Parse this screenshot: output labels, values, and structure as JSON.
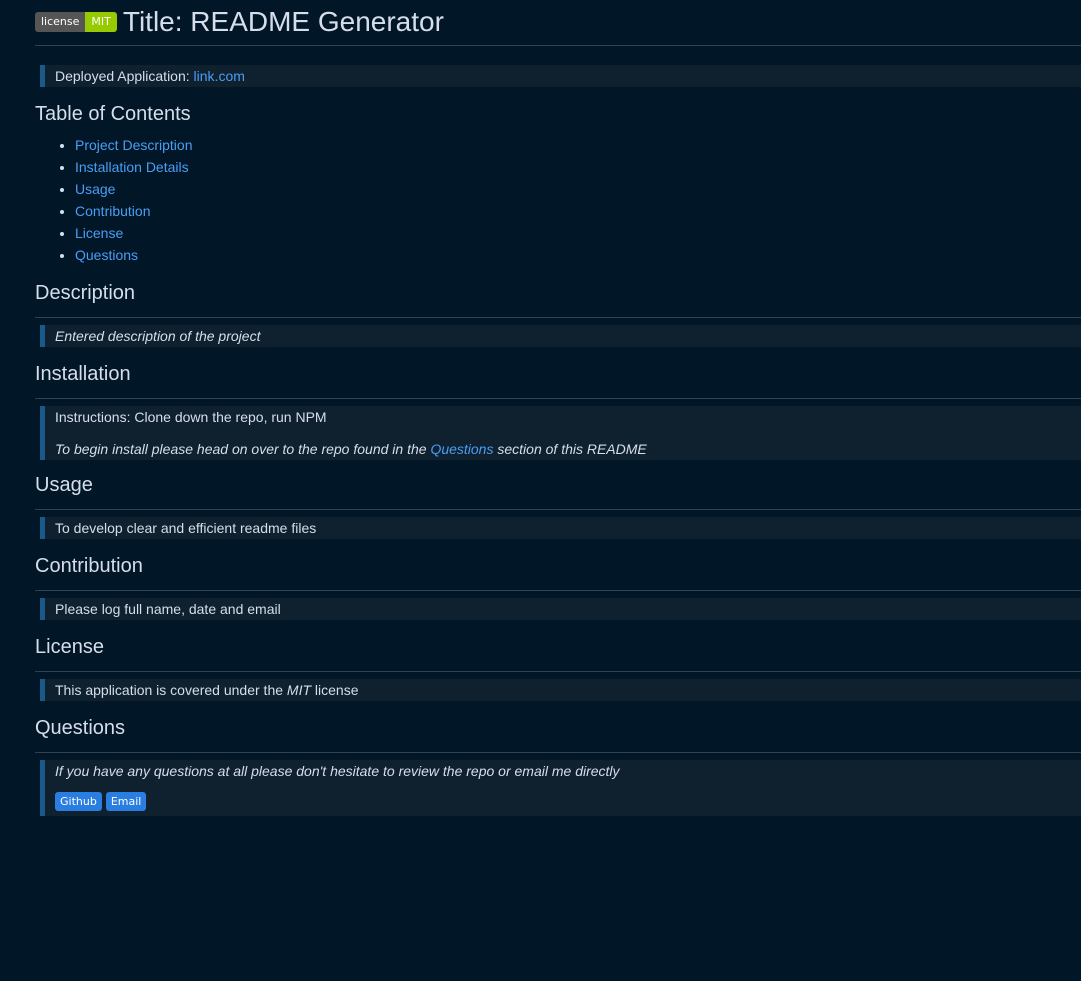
{
  "badge": {
    "label": "license",
    "value": "MIT"
  },
  "title": "Title: README Generator",
  "deployed": {
    "label": "Deployed Application: ",
    "link_text": "link.com"
  },
  "toc": {
    "heading": "Table of Contents",
    "items": [
      "Project Description",
      "Installation Details",
      "Usage",
      "Contribution",
      "License",
      "Questions"
    ]
  },
  "description": {
    "heading": "Description",
    "text": "Entered description of the project"
  },
  "installation": {
    "heading": "Installation",
    "instructions": "Instructions: Clone down the repo, run NPM",
    "note_before": "To begin install please head on over to the repo found in the ",
    "note_link": "Questions",
    "note_after": " section of this README"
  },
  "usage": {
    "heading": "Usage",
    "text": "To develop clear and efficient readme files"
  },
  "contribution": {
    "heading": "Contribution",
    "text": "Please log full name, date and email"
  },
  "license": {
    "heading": "License",
    "text_before": "This application is covered under the ",
    "text_license": "MIT",
    "text_after": " license"
  },
  "questions": {
    "heading": "Questions",
    "text": "If you have any questions at all please don't hesitate to review the repo or email me directly",
    "buttons": [
      "Github",
      "Email"
    ]
  },
  "colors": {
    "background": "#011627",
    "link": "#4a9ef5",
    "badge_value": "#97ca00",
    "quote_border": "#1a5a8a",
    "button": "#2a7de1"
  }
}
